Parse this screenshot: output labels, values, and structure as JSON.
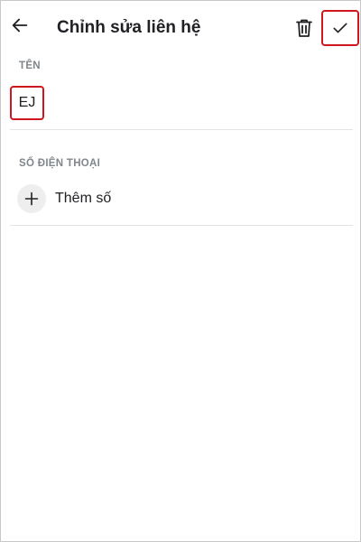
{
  "header": {
    "back_icon": "arrow-left-icon",
    "title": "Chỉnh sửa liên hệ",
    "delete_icon": "trash-icon",
    "save_icon": "check-icon"
  },
  "name_section": {
    "label": "TÊN",
    "value": "EJ"
  },
  "phone_section": {
    "label": "SỐ ĐIỆN THOẠI",
    "add_icon": "plus-icon",
    "add_label": "Thêm số"
  },
  "colors": {
    "highlight": "#d0171f",
    "text": "#202124",
    "label": "#80868b",
    "divider": "#e3e3e3",
    "add_circle_bg": "#eeeeee"
  }
}
